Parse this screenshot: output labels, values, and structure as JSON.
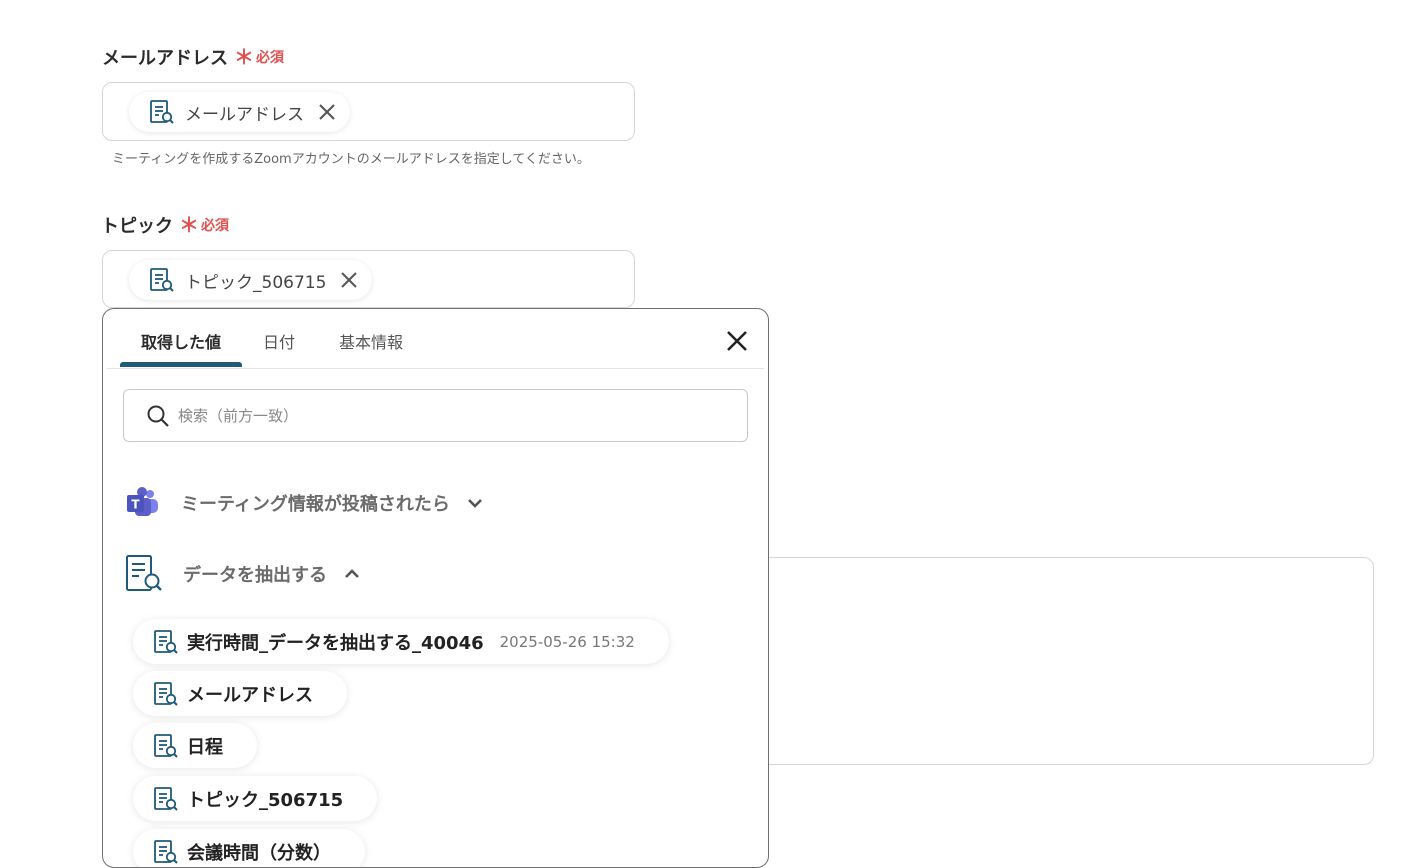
{
  "form": {
    "email": {
      "label": "メールアドレス",
      "required_star": "＊",
      "required_text": "必須",
      "chip": "メールアドレス",
      "help": "ミーティングを作成するZoomアカウントのメールアドレスを指定してください。"
    },
    "topic": {
      "label": "トピック",
      "required_star": "＊",
      "required_text": "必須",
      "chip": "トピック_506715"
    }
  },
  "popup": {
    "tabs": [
      {
        "label": "取得した値",
        "active": true
      },
      {
        "label": "日付",
        "active": false
      },
      {
        "label": "基本情報",
        "active": false
      }
    ],
    "search": {
      "placeholder": "検索（前方一致）"
    },
    "sections": [
      {
        "label": "ミーティング情報が投稿されたら",
        "icon": "teams-icon",
        "expanded": false
      },
      {
        "label": "データを抽出する",
        "icon": "document-search-icon",
        "expanded": true
      }
    ],
    "items": [
      {
        "name": "実行時間_データを抽出する_40046",
        "meta": "2025-05-26 15:32"
      },
      {
        "name": "メールアドレス"
      },
      {
        "name": "日程"
      },
      {
        "name": "トピック_506715"
      },
      {
        "name": "会議時間（分数）"
      }
    ]
  },
  "colors": {
    "accent": "#1f5a7a",
    "required": "#e05252",
    "teams_purple": "#5b5fc7"
  }
}
